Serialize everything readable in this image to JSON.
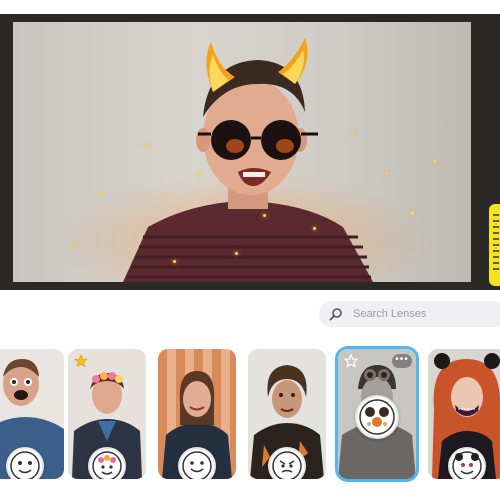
{
  "search": {
    "placeholder": "Search Lenses",
    "icon": "search-icon"
  },
  "lenses": [
    {
      "name": "lens-1",
      "favorited": false,
      "selected": false
    },
    {
      "name": "lens-2",
      "favorited": true,
      "selected": false
    },
    {
      "name": "lens-3",
      "favorited": false,
      "selected": false
    },
    {
      "name": "lens-4",
      "favorited": false,
      "selected": false
    },
    {
      "name": "lens-5",
      "favorited": false,
      "selected": true
    },
    {
      "name": "lens-6",
      "favorited": false,
      "selected": false
    }
  ],
  "more_label": "•••",
  "colors": {
    "accent_selected": "#52b7f0",
    "snap_yellow": "#f6e21a",
    "search_bg": "#f0f0f2"
  }
}
